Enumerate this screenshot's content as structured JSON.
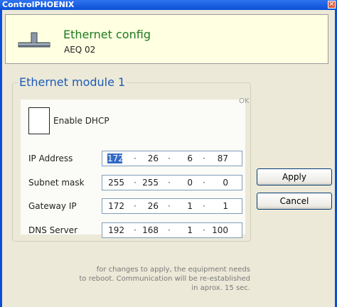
{
  "window": {
    "title": "ControlPHOENIX",
    "close_symbol": "✕"
  },
  "header": {
    "icon": "ethernet-connector-icon",
    "title": "Ethernet config",
    "subtitle": "AEQ 02"
  },
  "module": {
    "title": "Ethernet module 1",
    "ok_label": "OK",
    "dhcp_label": "Enable DHCP",
    "dhcp_checked": false,
    "fields": [
      {
        "label": "IP Address",
        "octets": [
          "172",
          "26",
          "6",
          "87"
        ]
      },
      {
        "label": "Subnet mask",
        "octets": [
          "255",
          "255",
          "0",
          "0"
        ]
      },
      {
        "label": "Gateway IP",
        "octets": [
          "172",
          "26",
          "1",
          "1"
        ]
      },
      {
        "label": "DNS Server",
        "octets": [
          "192",
          "168",
          "1",
          "100"
        ]
      }
    ],
    "separator": "·"
  },
  "buttons": {
    "apply": "Apply",
    "cancel": "Cancel"
  },
  "note": {
    "line1": "for changes to apply, the equipment needs",
    "line2": "to reboot. Communication will be re-established",
    "line3": "in aprox. 15 sec."
  },
  "colors": {
    "titlebar": "#0b4fd6",
    "header_bg": "#ffffe1",
    "header_title": "#1e7a1e",
    "group_title": "#1c5cb8",
    "selection": "#316ac5"
  }
}
